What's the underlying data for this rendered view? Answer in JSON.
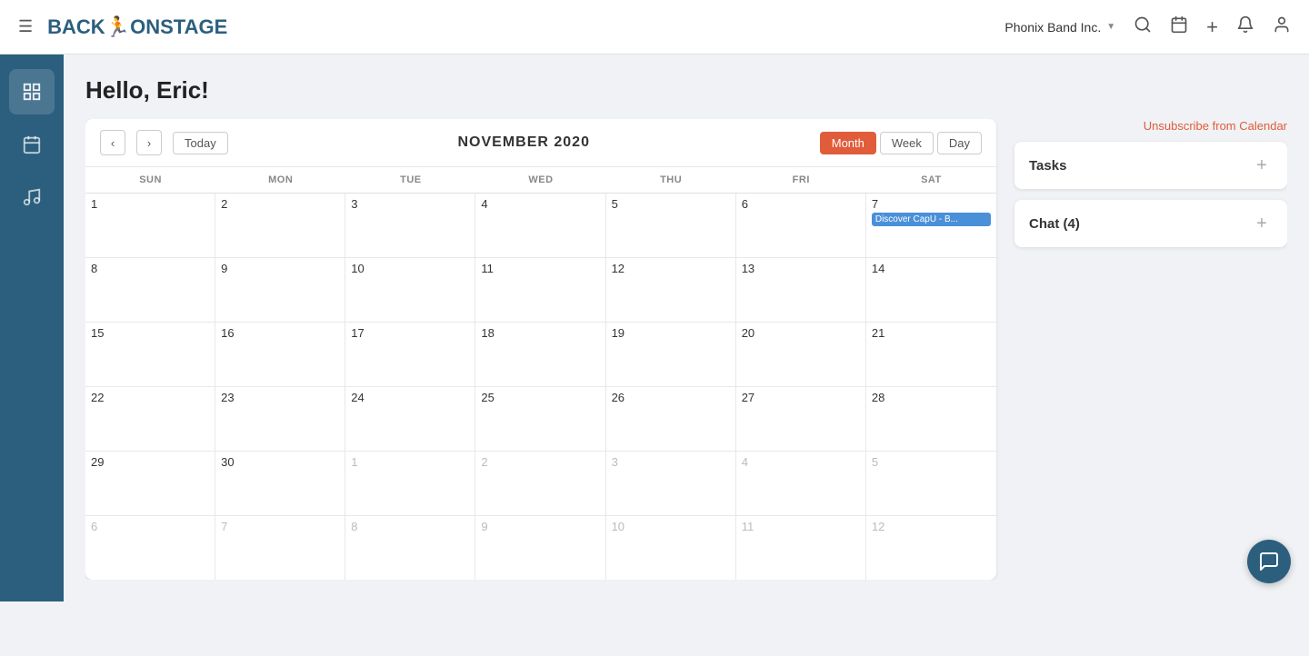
{
  "topnav": {
    "hamburger_label": "☰",
    "logo_back": "BACK",
    "logo_onstage": "ONSTAGE",
    "brand": "Phonix Band Inc.",
    "brand_caret": "▼",
    "icons": {
      "search": "🔍",
      "calendar": "📅",
      "add": "+",
      "bell": "🔔",
      "user": "👤"
    }
  },
  "sidebar": {
    "items": [
      {
        "name": "grid-icon",
        "icon": "⊞",
        "active": true
      },
      {
        "name": "calendar-icon",
        "icon": "📅",
        "active": false
      },
      {
        "name": "music-icon",
        "icon": "♪",
        "active": false
      }
    ]
  },
  "page": {
    "greeting": "Hello, Eric!",
    "unsubscribe_label": "Unsubscribe from Calendar"
  },
  "calendar": {
    "title": "NOVEMBER 2020",
    "today_label": "Today",
    "prev_label": "‹",
    "next_label": "›",
    "views": [
      {
        "label": "Month",
        "active": true
      },
      {
        "label": "Week",
        "active": false
      },
      {
        "label": "Day",
        "active": false
      }
    ],
    "day_headers": [
      "SUN",
      "MON",
      "TUE",
      "WED",
      "THU",
      "FRI",
      "SAT"
    ],
    "weeks": [
      {
        "days": [
          {
            "date": "1",
            "other": false,
            "events": []
          },
          {
            "date": "2",
            "other": false,
            "events": []
          },
          {
            "date": "3",
            "other": false,
            "events": []
          },
          {
            "date": "4",
            "other": false,
            "events": []
          },
          {
            "date": "5",
            "other": false,
            "events": []
          },
          {
            "date": "6",
            "other": false,
            "events": []
          },
          {
            "date": "7",
            "other": false,
            "events": [
              {
                "label": "Discover CapU - B..."
              }
            ]
          }
        ]
      },
      {
        "days": [
          {
            "date": "8",
            "other": false,
            "events": []
          },
          {
            "date": "9",
            "other": false,
            "events": []
          },
          {
            "date": "10",
            "other": false,
            "events": []
          },
          {
            "date": "11",
            "other": false,
            "events": []
          },
          {
            "date": "12",
            "other": false,
            "events": []
          },
          {
            "date": "13",
            "other": false,
            "events": []
          },
          {
            "date": "14",
            "other": false,
            "events": []
          }
        ]
      },
      {
        "days": [
          {
            "date": "15",
            "other": false,
            "events": []
          },
          {
            "date": "16",
            "other": false,
            "events": []
          },
          {
            "date": "17",
            "other": false,
            "events": []
          },
          {
            "date": "18",
            "other": false,
            "events": []
          },
          {
            "date": "19",
            "other": false,
            "events": []
          },
          {
            "date": "20",
            "other": false,
            "events": []
          },
          {
            "date": "21",
            "other": false,
            "events": []
          }
        ]
      },
      {
        "days": [
          {
            "date": "22",
            "other": false,
            "events": []
          },
          {
            "date": "23",
            "other": false,
            "events": []
          },
          {
            "date": "24",
            "other": false,
            "events": []
          },
          {
            "date": "25",
            "other": false,
            "events": []
          },
          {
            "date": "26",
            "other": false,
            "events": []
          },
          {
            "date": "27",
            "other": false,
            "events": []
          },
          {
            "date": "28",
            "other": false,
            "events": []
          }
        ]
      },
      {
        "days": [
          {
            "date": "29",
            "other": false,
            "events": []
          },
          {
            "date": "30",
            "other": false,
            "events": []
          },
          {
            "date": "1",
            "other": true,
            "events": []
          },
          {
            "date": "2",
            "other": true,
            "events": []
          },
          {
            "date": "3",
            "other": true,
            "events": []
          },
          {
            "date": "4",
            "other": true,
            "events": []
          },
          {
            "date": "5",
            "other": true,
            "events": []
          }
        ]
      },
      {
        "days": [
          {
            "date": "6",
            "other": true,
            "events": []
          },
          {
            "date": "7",
            "other": true,
            "events": []
          },
          {
            "date": "8",
            "other": true,
            "events": []
          },
          {
            "date": "9",
            "other": true,
            "events": []
          },
          {
            "date": "10",
            "other": true,
            "events": []
          },
          {
            "date": "11",
            "other": true,
            "events": []
          },
          {
            "date": "12",
            "other": true,
            "events": []
          }
        ]
      }
    ]
  },
  "tasks": {
    "title": "Tasks",
    "add_label": "+"
  },
  "chat": {
    "title": "Chat (4)",
    "add_label": "+",
    "count": 4
  },
  "chat_fab": {
    "icon": "💬"
  }
}
